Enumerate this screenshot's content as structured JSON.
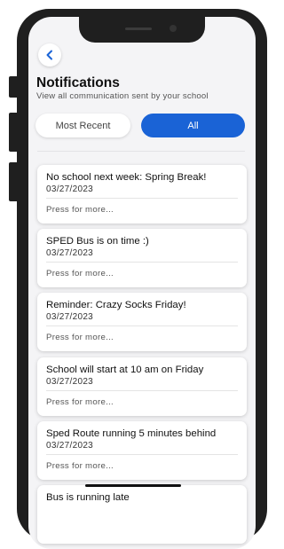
{
  "header": {
    "title": "Notifications",
    "subtitle": "View all communication sent by your school"
  },
  "tabs": [
    {
      "label": "Most Recent",
      "selected": false
    },
    {
      "label": "All",
      "selected": true
    }
  ],
  "colors": {
    "accent": "#1a63d6",
    "background": "#f4f4f6"
  },
  "notifications": [
    {
      "title": "No school next week: Spring Break!",
      "date": "03/27/2023",
      "action": "Press for more..."
    },
    {
      "title": "SPED Bus is on time :)",
      "date": "03/27/2023",
      "action": "Press for more..."
    },
    {
      "title": "Reminder: Crazy Socks Friday!",
      "date": "03/27/2023",
      "action": "Press for more..."
    },
    {
      "title": "School will start at 10 am on Friday",
      "date": "03/27/2023",
      "action": "Press for more..."
    },
    {
      "title": "Sped Route running 5 minutes behind",
      "date": "03/27/2023",
      "action": "Press for more..."
    },
    {
      "title": "Bus is running late",
      "date": "",
      "action": ""
    }
  ],
  "icons": {
    "back": "chevron-left-icon"
  }
}
